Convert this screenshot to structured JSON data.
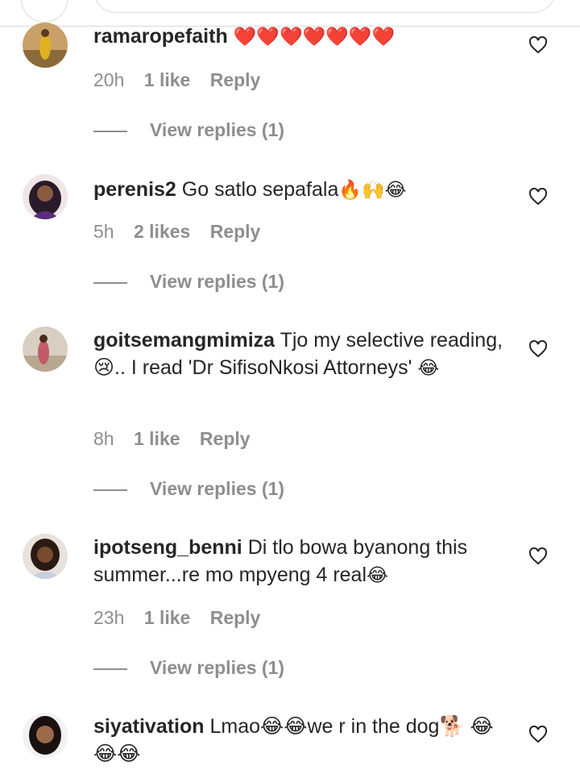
{
  "comments": [
    {
      "username": "ramaropefaith",
      "text": "",
      "emoji": "❤️❤️❤️❤️❤️❤️❤️",
      "time": "20h",
      "likes": "1 like",
      "reply": "Reply",
      "view_replies": "View replies (1)"
    },
    {
      "username": "perenis2",
      "text": "Go satlo sepafala",
      "emoji": "🔥🙌😂",
      "time": "5h",
      "likes": "2 likes",
      "reply": "Reply",
      "view_replies": "View replies (1)"
    },
    {
      "username": "goitsemangmimiza",
      "text": "Tjo my selective reading, 😢.. I read 'Dr SifisoNkosi Attorneys'",
      "emoji": "😂",
      "time": "8h",
      "likes": "1 like",
      "reply": "Reply",
      "view_replies": "View replies (1)"
    },
    {
      "username": "ipotseng_benni",
      "text": "Di tlo bowa byanong this summer...re mo mpyeng 4 real",
      "emoji": "😂",
      "time": "23h",
      "likes": "1 like",
      "reply": "Reply",
      "view_replies": "View replies (1)"
    },
    {
      "username": "siyativation",
      "text": "Lmao😂😂we r in the dog🐕 😂😂😂",
      "emoji": "",
      "time": "",
      "likes": "",
      "reply": "",
      "view_replies": ""
    }
  ],
  "icons": {
    "like": "heart-outline-icon"
  },
  "colors": {
    "text": "#262626",
    "meta": "#8e8e8e",
    "heart_stroke": "#262626",
    "divider": "#dbdbdb"
  }
}
